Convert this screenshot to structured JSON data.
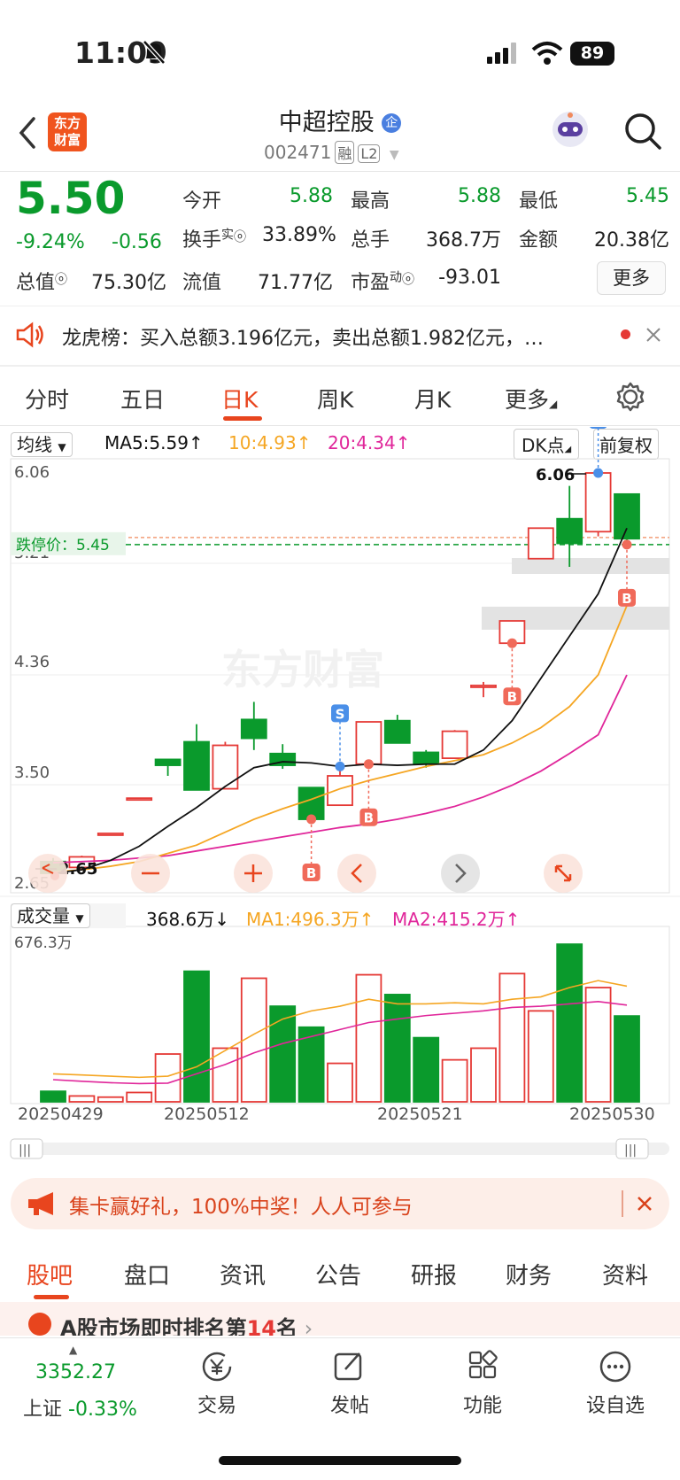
{
  "status_bar": {
    "time": "11:09",
    "battery": "89"
  },
  "header": {
    "logo_line1": "东方",
    "logo_line2": "财富",
    "stock_name": "中超控股",
    "stock_code": "002471",
    "tag1": "融",
    "tag2": "L2"
  },
  "quote": {
    "price": "5.50",
    "change_pct": "-9.24%",
    "change_abs": "-0.56",
    "open_label": "今开",
    "open": "5.88",
    "high_label": "最高",
    "high": "5.88",
    "low_label": "最低",
    "low": "5.45",
    "turnover_label": "换手",
    "turnover_sup": "实",
    "turnover": "33.89%",
    "volume_label": "总手",
    "volume": "368.7万",
    "amount_label": "金额",
    "amount": "20.38亿",
    "mktcap_label": "总值",
    "mktcap": "75.30亿",
    "float_label": "流值",
    "float": "71.77亿",
    "pe_label": "市盈",
    "pe_sup": "动",
    "pe": "-93.01",
    "more_label": "更多"
  },
  "notice": {
    "text": "龙虎榜：买入总额3.196亿元，卖出总额1.982亿元，…"
  },
  "period_tabs": [
    "分时",
    "五日",
    "日K",
    "周K",
    "月K",
    "更多"
  ],
  "ma_bar": {
    "select": "均线",
    "ma5": "MA5:5.59↑",
    "ma10": "10:4.93↑",
    "ma20": "20:4.34↑",
    "dk": "DK点",
    "fq": "前复权"
  },
  "vol_bar": {
    "select": "成交量",
    "vol": "368.6万↓",
    "ma1": "MA1:496.3万↑",
    "ma2": "MA2:415.2万↑",
    "max_label": "676.3万"
  },
  "colors": {
    "up": "#e53935",
    "down": "#0a9a2c",
    "ma5": "#111111",
    "ma10": "#f5a623",
    "ma20": "#e0269a",
    "accent": "#e8451e"
  },
  "chart_data": [
    {
      "type": "candlestick",
      "title": "",
      "y_ticks": [
        "6.06",
        "5.21",
        "4.36",
        "3.50",
        "2.65"
      ],
      "limit_down_label": "跌停价：5.45",
      "limit_down": 5.45,
      "high_marker": "6.06",
      "low_marker": "2.65",
      "ylim": [
        2.65,
        6.06
      ],
      "candles": [
        {
          "o": 2.75,
          "c": 2.65,
          "h": 2.78,
          "l": 2.62
        },
        {
          "o": 2.7,
          "c": 2.79,
          "h": 2.8,
          "l": 2.68
        },
        {
          "o": 2.99,
          "c": 2.99,
          "h": 2.99,
          "l": 2.99
        },
        {
          "o": 3.29,
          "c": 3.29,
          "h": 3.29,
          "l": 3.29
        },
        {
          "o": 3.62,
          "c": 3.57,
          "h": 3.62,
          "l": 3.48
        },
        {
          "o": 3.77,
          "c": 3.36,
          "h": 3.92,
          "l": 3.36
        },
        {
          "o": 3.37,
          "c": 3.74,
          "h": 3.77,
          "l": 3.37
        },
        {
          "o": 3.96,
          "c": 3.8,
          "h": 4.11,
          "l": 3.7
        },
        {
          "o": 3.67,
          "c": 3.57,
          "h": 3.75,
          "l": 3.54
        },
        {
          "o": 3.38,
          "c": 3.11,
          "h": 3.38,
          "l": 3.11
        },
        {
          "o": 3.23,
          "c": 3.48,
          "h": 3.56,
          "l": 3.23
        },
        {
          "o": 3.58,
          "c": 3.94,
          "h": 3.94,
          "l": 3.58
        },
        {
          "o": 3.95,
          "c": 3.76,
          "h": 4.0,
          "l": 3.76
        },
        {
          "o": 3.68,
          "c": 3.58,
          "h": 3.7,
          "l": 3.55
        },
        {
          "o": 3.63,
          "c": 3.86,
          "h": 3.87,
          "l": 3.63
        },
        {
          "o": 4.25,
          "c": 4.25,
          "h": 4.28,
          "l": 4.15
        },
        {
          "o": 4.61,
          "c": 4.8,
          "h": 4.8,
          "l": 4.61
        },
        {
          "o": 5.33,
          "c": 5.59,
          "h": 5.59,
          "l": 5.33
        },
        {
          "o": 5.67,
          "c": 5.46,
          "h": 5.95,
          "l": 5.26
        },
        {
          "o": 5.56,
          "c": 6.06,
          "h": 6.06,
          "l": 5.52
        },
        {
          "o": 5.88,
          "c": 5.5,
          "h": 5.88,
          "l": 5.45
        }
      ],
      "ma5": [
        2.65,
        2.68,
        2.76,
        2.88,
        3.05,
        3.21,
        3.39,
        3.55,
        3.6,
        3.59,
        3.56,
        3.58,
        3.57,
        3.58,
        3.58,
        3.7,
        3.95,
        4.31,
        4.67,
        5.03,
        5.59
      ],
      "ma10": [
        2.66,
        2.68,
        2.71,
        2.75,
        2.82,
        2.89,
        3.0,
        3.11,
        3.2,
        3.28,
        3.37,
        3.44,
        3.5,
        3.56,
        3.61,
        3.66,
        3.76,
        3.89,
        4.07,
        4.34,
        4.93
      ],
      "ma20": [
        2.74,
        2.75,
        2.76,
        2.78,
        2.8,
        2.84,
        2.88,
        2.92,
        2.96,
        3.0,
        3.04,
        3.07,
        3.11,
        3.16,
        3.22,
        3.3,
        3.4,
        3.52,
        3.67,
        3.83,
        4.34
      ],
      "signals": [
        {
          "idx": 9,
          "type": "B"
        },
        {
          "idx": 10,
          "type": "S"
        },
        {
          "idx": 11,
          "type": "B"
        },
        {
          "idx": 16,
          "type": "B"
        },
        {
          "idx": 19,
          "type": "S"
        },
        {
          "idx": 20,
          "type": "B"
        }
      ]
    },
    {
      "type": "bar",
      "title": "",
      "ylim": [
        0,
        676.3
      ],
      "unit": "万",
      "values": [
        45,
        25,
        20,
        40,
        205,
        560,
        230,
        530,
        410,
        320,
        165,
        545,
        460,
        275,
        180,
        230,
        550,
        390,
        676,
        490,
        368
      ],
      "up": [
        false,
        true,
        true,
        true,
        true,
        false,
        true,
        true,
        false,
        false,
        true,
        true,
        false,
        false,
        true,
        true,
        true,
        true,
        false,
        true,
        false
      ],
      "ma1": [
        120,
        115,
        110,
        105,
        110,
        150,
        220,
        290,
        355,
        390,
        410,
        440,
        420,
        420,
        425,
        420,
        440,
        450,
        490,
        520,
        496
      ],
      "ma2": [
        95,
        88,
        82,
        78,
        80,
        120,
        160,
        210,
        250,
        280,
        310,
        340,
        355,
        370,
        380,
        390,
        405,
        410,
        420,
        430,
        415
      ],
      "x_labels": [
        "20250429",
        "20250512",
        "20250521",
        "20250530"
      ]
    }
  ],
  "banner": {
    "text": "集卡赢好礼，100%中奖！人人可参与"
  },
  "bottom_tabs": [
    "股吧",
    "盘口",
    "资讯",
    "公告",
    "研报",
    "财务",
    "资料"
  ],
  "rank_strip": {
    "prefix": "A股市场即时排名第",
    "rank": "14",
    "suffix": "名"
  },
  "index": {
    "value": "3352.27",
    "name": "上证",
    "change": "-0.33%"
  },
  "nav": [
    "交易",
    "发帖",
    "功能",
    "设自选"
  ]
}
